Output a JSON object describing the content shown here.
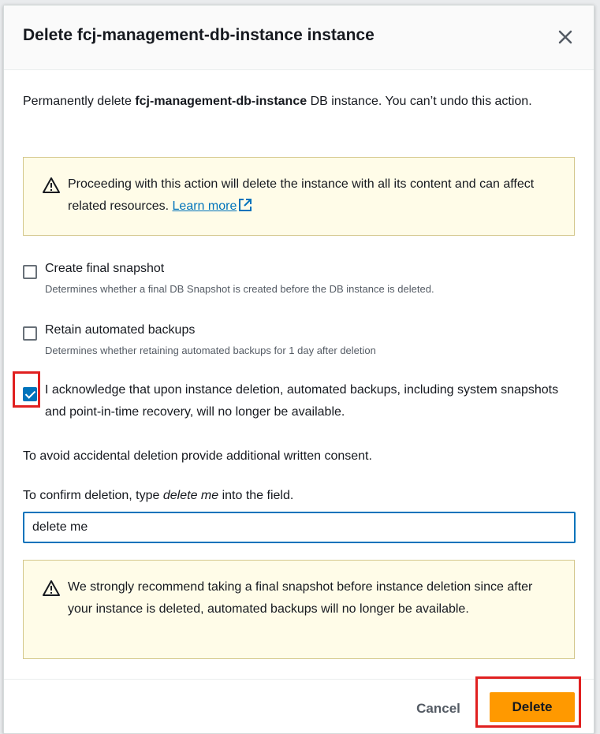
{
  "modal": {
    "title": "Delete fcj-management-db-instance instance",
    "intro_prefix": "Permanently delete ",
    "intro_bold": "fcj-management-db-instance",
    "intro_suffix": " DB instance. You can’t undo this action."
  },
  "alert_top": {
    "text": "Proceeding with this action will delete the instance with all its content and can affect related resources. ",
    "link": "Learn more"
  },
  "options": [
    {
      "label": "Create final snapshot",
      "description": "Determines whether a final DB Snapshot is created before the DB instance is deleted.",
      "checked": false
    },
    {
      "label": "Retain automated backups",
      "description": "Determines whether retaining automated backups for 1 day after deletion",
      "checked": false
    },
    {
      "label": "I acknowledge that upon instance deletion, automated backups, including system snapshots and point-in-time recovery, will no longer be available.",
      "checked": true
    }
  ],
  "consent_text": "To avoid accidental deletion provide additional written consent.",
  "confirm": {
    "prefix": "To confirm deletion, type ",
    "phrase": "delete me",
    "suffix": " into the field.",
    "value": "delete me"
  },
  "alert_bottom": {
    "text": "We strongly recommend taking a final snapshot before instance deletion since after your instance is deleted, automated backups will no longer be available."
  },
  "footer": {
    "cancel_label": "Cancel",
    "delete_label": "Delete"
  },
  "colors": {
    "primary_button": "#ff9900",
    "link": "#0073bb",
    "warning_bg": "#fffce8",
    "highlight": "#e02020"
  }
}
